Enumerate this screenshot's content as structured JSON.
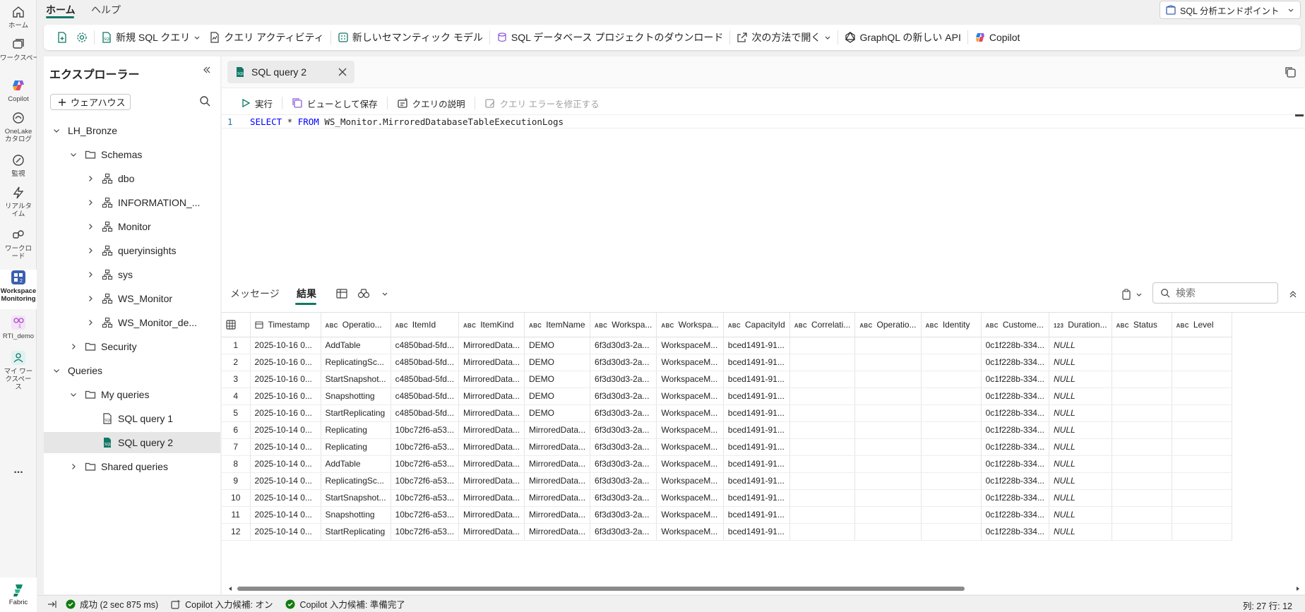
{
  "rail": {
    "items": [
      {
        "label": "ホーム",
        "icon": "home-icon"
      },
      {
        "label": "ワークスペース",
        "icon": "workspaces-icon"
      },
      {
        "label": "Copilot",
        "icon": "copilot-icon"
      },
      {
        "label": "OneLake カタログ",
        "icon": "onelake-catalog-icon"
      },
      {
        "label": "監視",
        "icon": "monitor-icon"
      },
      {
        "label": "リアルタイム",
        "icon": "realtime-icon"
      },
      {
        "label": "ワークロード",
        "icon": "workload-icon"
      },
      {
        "label": "Workspace Monitoring",
        "icon": "workspace-monitoring-icon"
      },
      {
        "label": "RTI_demo",
        "icon": "rti-demo-icon"
      },
      {
        "label": "マイ ワークスペース",
        "icon": "my-workspace-icon"
      },
      {
        "label": "...",
        "icon": "more-icon"
      }
    ],
    "footer": "Fabric"
  },
  "menubar": {
    "tabs": [
      "ホーム",
      "ヘルプ"
    ],
    "endpoint_label": "SQL 分析エンドポイント"
  },
  "ribbon": {
    "new_sql_query": "新規 SQL クエリ",
    "query_activity": "クエリ アクティビティ",
    "new_semantic_model": "新しいセマンティック モデル",
    "download_project": "SQL データベース プロジェクトのダウンロード",
    "open_with": "次の方法で開く",
    "graphql": "GraphQL の新しい API",
    "copilot": "Copilot"
  },
  "explorer": {
    "title": "エクスプローラー",
    "warehouse_button": "ウェアハウス",
    "tree": [
      {
        "label": "LH_Bronze",
        "level": 0,
        "expanded": true,
        "icon": "none"
      },
      {
        "label": "Schemas",
        "level": 1,
        "expanded": true,
        "icon": "folder"
      },
      {
        "label": "dbo",
        "level": 2,
        "expanded": false,
        "icon": "schema"
      },
      {
        "label": "INFORMATION_...",
        "level": 2,
        "expanded": false,
        "icon": "schema"
      },
      {
        "label": "Monitor",
        "level": 2,
        "expanded": false,
        "icon": "schema"
      },
      {
        "label": "queryinsights",
        "level": 2,
        "expanded": false,
        "icon": "schema"
      },
      {
        "label": "sys",
        "level": 2,
        "expanded": false,
        "icon": "schema"
      },
      {
        "label": "WS_Monitor",
        "level": 2,
        "expanded": false,
        "icon": "schema"
      },
      {
        "label": "WS_Monitor_de...",
        "level": 2,
        "expanded": false,
        "icon": "schema"
      },
      {
        "label": "Security",
        "level": 1,
        "expanded": false,
        "icon": "folder"
      },
      {
        "label": "Queries",
        "level": 0,
        "expanded": true,
        "icon": "none"
      },
      {
        "label": "My queries",
        "level": 1,
        "expanded": true,
        "icon": "folder"
      },
      {
        "label": "SQL query 1",
        "level": 2,
        "expanded": null,
        "icon": "sqlfile"
      },
      {
        "label": "SQL query 2",
        "level": 2,
        "expanded": null,
        "icon": "sqlfile-active",
        "selected": true
      },
      {
        "label": "Shared queries",
        "level": 1,
        "expanded": false,
        "icon": "folder"
      }
    ]
  },
  "editor": {
    "tab_title": "SQL query 2",
    "toolbar": {
      "run": "実行",
      "save_as_view": "ビューとして保存",
      "explain_query": "クエリの説明",
      "fix_errors": "クエリ エラーを修正する"
    },
    "line_number": "1",
    "code": {
      "kw1": "SELECT",
      "star": " * ",
      "kw2": "FROM",
      "rest": " WS_Monitor.MirroredDatabaseTableExecutionLogs"
    }
  },
  "results": {
    "tabs": [
      "メッセージ",
      "結果"
    ],
    "search_placeholder": "検索",
    "columns": [
      {
        "type": "cal",
        "name": "Timestamp"
      },
      {
        "type": "ABC",
        "name": "Operatio..."
      },
      {
        "type": "ABC",
        "name": "ItemId"
      },
      {
        "type": "ABC",
        "name": "ItemKind"
      },
      {
        "type": "ABC",
        "name": "ItemName"
      },
      {
        "type": "ABC",
        "name": "Workspa..."
      },
      {
        "type": "ABC",
        "name": "Workspa..."
      },
      {
        "type": "ABC",
        "name": "CapacityId"
      },
      {
        "type": "ABC",
        "name": "Correlati..."
      },
      {
        "type": "ABC",
        "name": "Operatio..."
      },
      {
        "type": "ABC",
        "name": "Identity"
      },
      {
        "type": "ABC",
        "name": "Custome..."
      },
      {
        "type": "123",
        "name": "Duration..."
      },
      {
        "type": "ABC",
        "name": "Status"
      },
      {
        "type": "ABC",
        "name": "Level"
      }
    ],
    "rows": [
      [
        "1",
        "2025-10-16 0...",
        "AddTable",
        "c4850bad-5fd...",
        "MirroredData...",
        "DEMO",
        "6f3d30d3-2a...",
        "WorkspaceM...",
        "bced1491-91...",
        "",
        "",
        "",
        "0c1f228b-334...",
        "NULL",
        "",
        ""
      ],
      [
        "2",
        "2025-10-16 0...",
        "ReplicatingSc...",
        "c4850bad-5fd...",
        "MirroredData...",
        "DEMO",
        "6f3d30d3-2a...",
        "WorkspaceM...",
        "bced1491-91...",
        "",
        "",
        "",
        "0c1f228b-334...",
        "NULL",
        "",
        ""
      ],
      [
        "3",
        "2025-10-16 0...",
        "StartSnapshot...",
        "c4850bad-5fd...",
        "MirroredData...",
        "DEMO",
        "6f3d30d3-2a...",
        "WorkspaceM...",
        "bced1491-91...",
        "",
        "",
        "",
        "0c1f228b-334...",
        "NULL",
        "",
        ""
      ],
      [
        "4",
        "2025-10-16 0...",
        "Snapshotting",
        "c4850bad-5fd...",
        "MirroredData...",
        "DEMO",
        "6f3d30d3-2a...",
        "WorkspaceM...",
        "bced1491-91...",
        "",
        "",
        "",
        "0c1f228b-334...",
        "NULL",
        "",
        ""
      ],
      [
        "5",
        "2025-10-16 0...",
        "StartReplicating",
        "c4850bad-5fd...",
        "MirroredData...",
        "DEMO",
        "6f3d30d3-2a...",
        "WorkspaceM...",
        "bced1491-91...",
        "",
        "",
        "",
        "0c1f228b-334...",
        "NULL",
        "",
        ""
      ],
      [
        "6",
        "2025-10-14 0...",
        "Replicating",
        "10bc72f6-a53...",
        "MirroredData...",
        "MirroredData...",
        "6f3d30d3-2a...",
        "WorkspaceM...",
        "bced1491-91...",
        "",
        "",
        "",
        "0c1f228b-334...",
        "NULL",
        "",
        ""
      ],
      [
        "7",
        "2025-10-14 0...",
        "Replicating",
        "10bc72f6-a53...",
        "MirroredData...",
        "MirroredData...",
        "6f3d30d3-2a...",
        "WorkspaceM...",
        "bced1491-91...",
        "",
        "",
        "",
        "0c1f228b-334...",
        "NULL",
        "",
        ""
      ],
      [
        "8",
        "2025-10-14 0...",
        "AddTable",
        "10bc72f6-a53...",
        "MirroredData...",
        "MirroredData...",
        "6f3d30d3-2a...",
        "WorkspaceM...",
        "bced1491-91...",
        "",
        "",
        "",
        "0c1f228b-334...",
        "NULL",
        "",
        ""
      ],
      [
        "9",
        "2025-10-14 0...",
        "ReplicatingSc...",
        "10bc72f6-a53...",
        "MirroredData...",
        "MirroredData...",
        "6f3d30d3-2a...",
        "WorkspaceM...",
        "bced1491-91...",
        "",
        "",
        "",
        "0c1f228b-334...",
        "NULL",
        "",
        ""
      ],
      [
        "10",
        "2025-10-14 0...",
        "StartSnapshot...",
        "10bc72f6-a53...",
        "MirroredData...",
        "MirroredData...",
        "6f3d30d3-2a...",
        "WorkspaceM...",
        "bced1491-91...",
        "",
        "",
        "",
        "0c1f228b-334...",
        "NULL",
        "",
        ""
      ],
      [
        "11",
        "2025-10-14 0...",
        "Snapshotting",
        "10bc72f6-a53...",
        "MirroredData...",
        "MirroredData...",
        "6f3d30d3-2a...",
        "WorkspaceM...",
        "bced1491-91...",
        "",
        "",
        "",
        "0c1f228b-334...",
        "NULL",
        "",
        ""
      ],
      [
        "12",
        "2025-10-14 0...",
        "StartReplicating",
        "10bc72f6-a53...",
        "MirroredData...",
        "MirroredData...",
        "6f3d30d3-2a...",
        "WorkspaceM...",
        "bced1491-91...",
        "",
        "",
        "",
        "0c1f228b-334...",
        "NULL",
        "",
        ""
      ]
    ]
  },
  "statusbar": {
    "success": "成功 (2 sec 875 ms)",
    "copilot_input": "Copilot 入力候補: オン",
    "copilot_ready": "Copilot 入力候補: 準備完了",
    "position": "列: 27 行: 12"
  },
  "colors": {
    "accent": "#117865",
    "success": "#107c10",
    "keyword": "#0000ff"
  }
}
